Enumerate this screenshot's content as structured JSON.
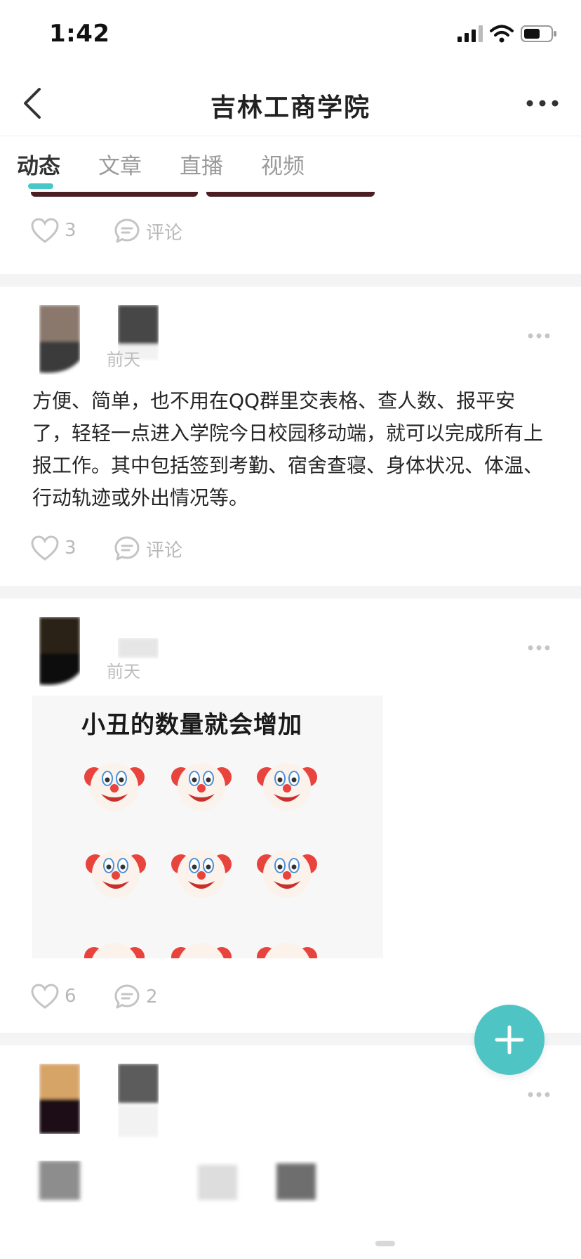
{
  "status_bar": {
    "time": "1:42"
  },
  "nav": {
    "title": "吉林工商学院"
  },
  "tabs": [
    {
      "label": "动态",
      "active": true
    },
    {
      "label": "文章",
      "active": false
    },
    {
      "label": "直播",
      "active": false
    },
    {
      "label": "视频",
      "active": false
    }
  ],
  "colors": {
    "accent": "#47c8c7",
    "fab": "#4fc4c4",
    "muted": "#b8b8b8"
  },
  "posts": [
    {
      "likes": "3",
      "comment_label": "评论"
    },
    {
      "time": "前天",
      "text": "方便、简单，也不用在QQ群里交表格、查人数、报平安了，轻轻一点进入学院今日校园移动端，就可以完成所有上报工作。其中包括签到考勤、宿舍查寝、身体状况、体温、行动轨迹或外出情况等。",
      "likes": "3",
      "comment_label": "评论"
    },
    {
      "time": "前天",
      "image_caption": "小丑的数量就会增加",
      "image_icon": "clown-face-emoji",
      "likes": "6",
      "comments": "2"
    }
  ],
  "icons": [
    "back-chevron-icon",
    "more-icon",
    "heart-icon",
    "comment-icon",
    "plus-icon",
    "signal-icon",
    "wifi-icon",
    "battery-icon"
  ]
}
